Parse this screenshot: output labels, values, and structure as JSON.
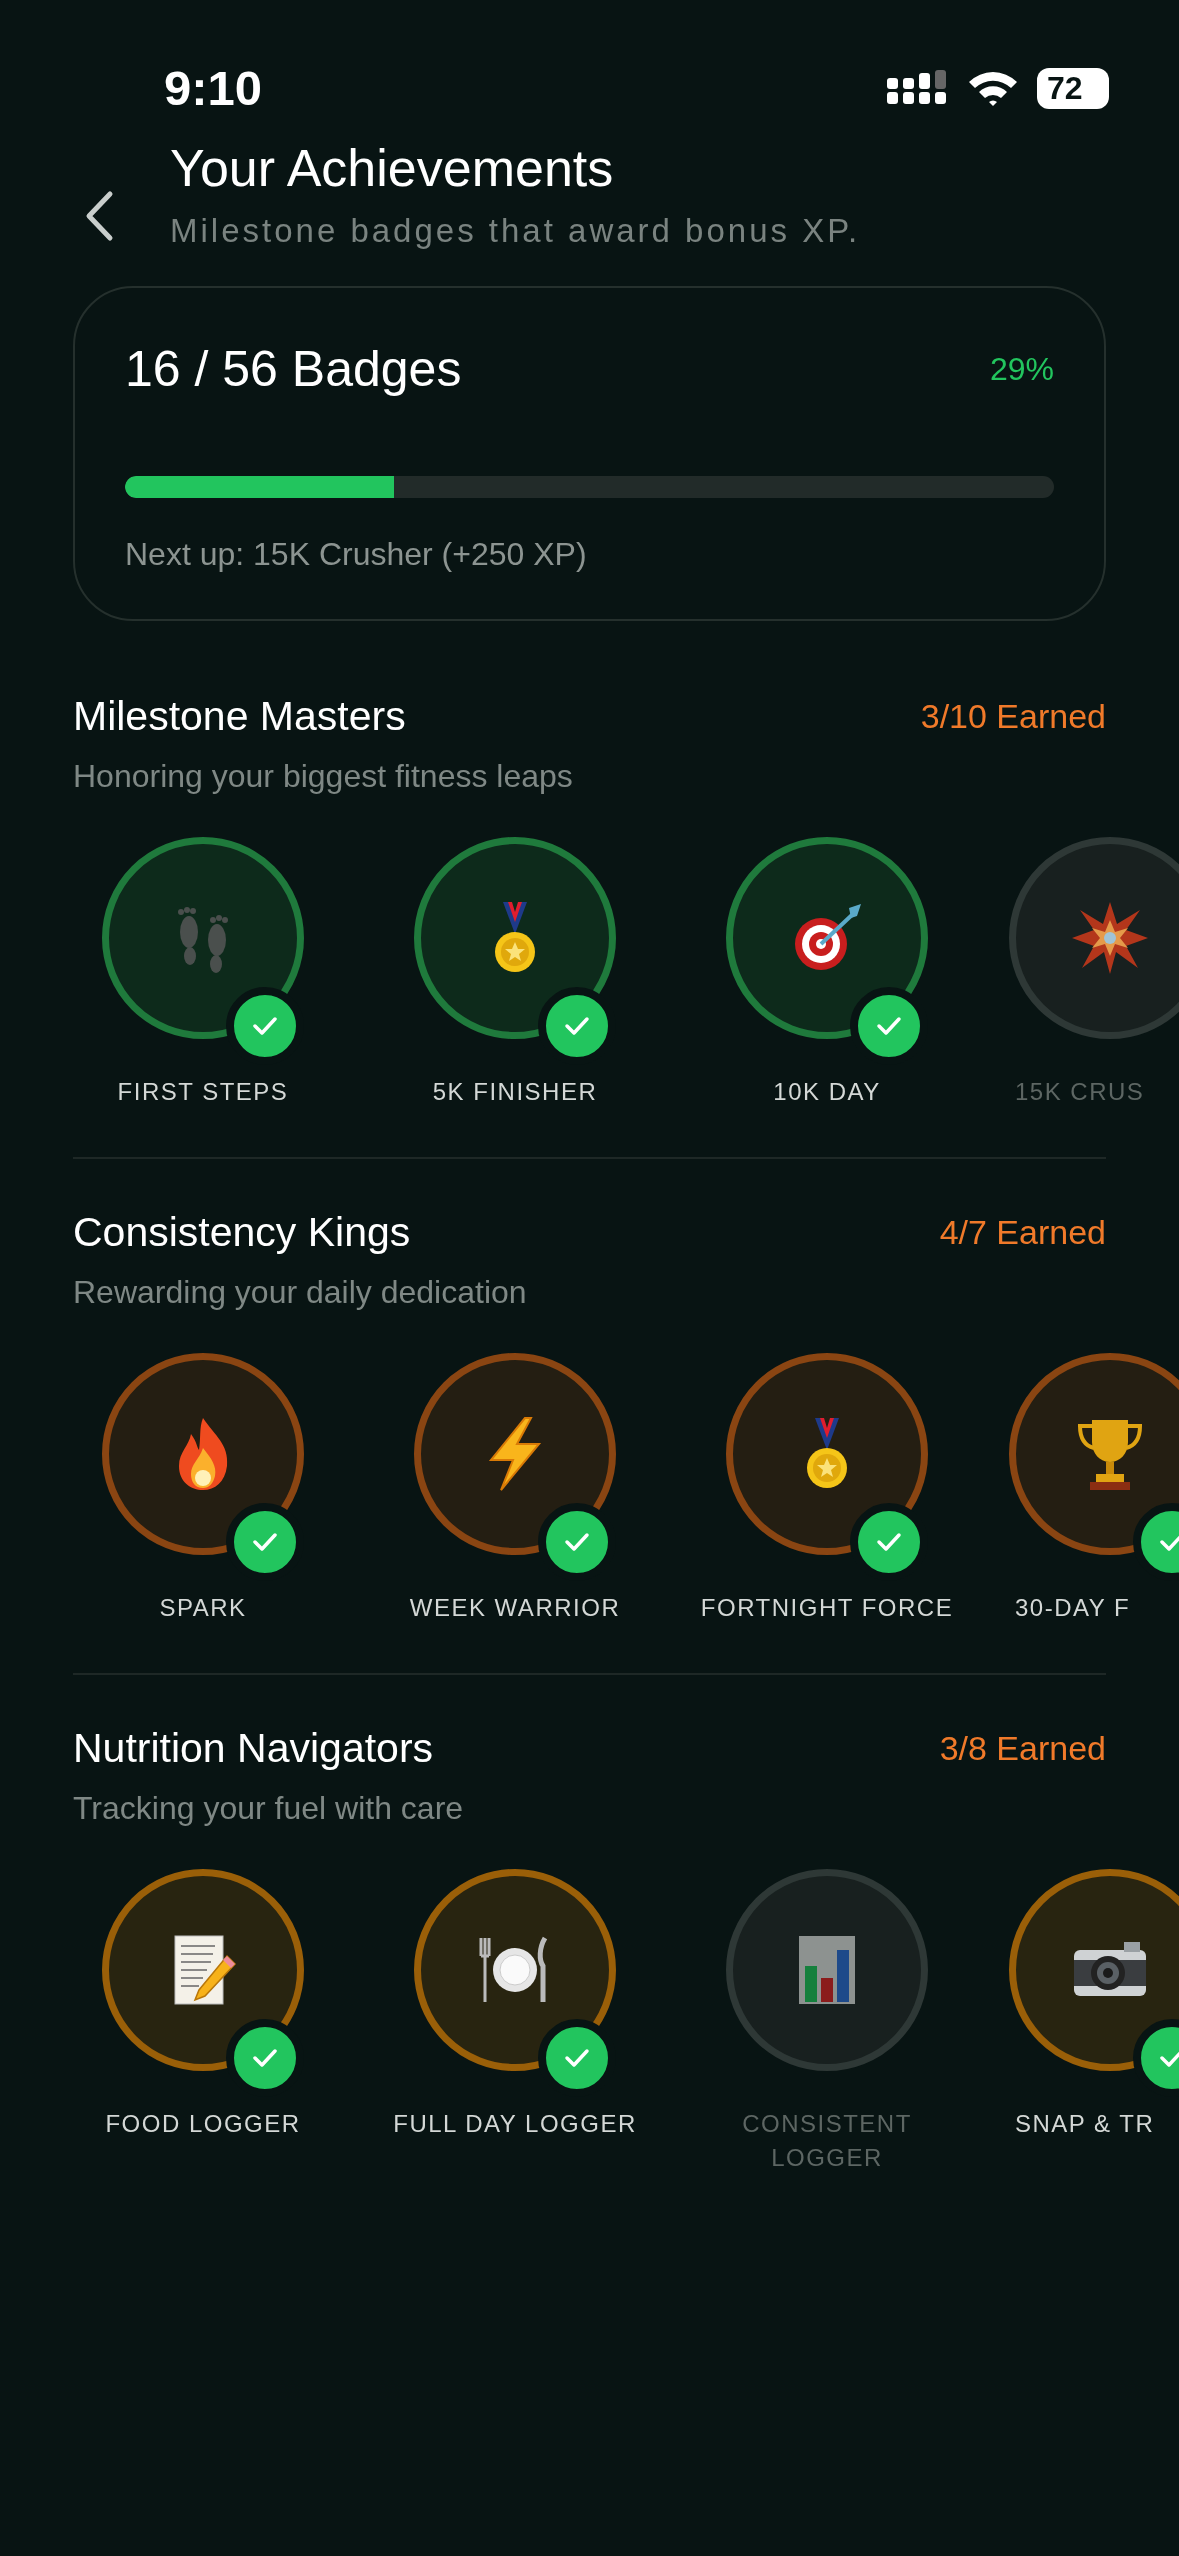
{
  "status_bar": {
    "time": "9:10",
    "battery": "72"
  },
  "header": {
    "title": "Your Achievements",
    "subtitle": "Milestone badges that award bonus XP."
  },
  "summary": {
    "title": "16 / 56 Badges",
    "percent": "29%",
    "level": 0.29,
    "next_up": "Next up: 15K Crusher (+250 XP)"
  },
  "sections": [
    {
      "title": "Milestone Masters",
      "count": "3/10 Earned",
      "subtitle": "Honoring your biggest fitness leaps",
      "color": "#1f7a3c",
      "badges": [
        {
          "label": "FIRST STEPS",
          "earned": true
        },
        {
          "label": "5K FINISHER",
          "earned": true
        },
        {
          "label": "10K DAY",
          "earned": true
        },
        {
          "label": "15K CRUS",
          "earned": false
        }
      ]
    },
    {
      "title": "Consistency Kings",
      "count": "4/7 Earned",
      "subtitle": "Rewarding your daily dedication",
      "color": "#8a4512",
      "badges": [
        {
          "label": "SPARK",
          "earned": true
        },
        {
          "label": "WEEK WARRIOR",
          "earned": true
        },
        {
          "label": "FORTNIGHT FORCE",
          "earned": true
        },
        {
          "label": "30-DAY F",
          "earned": true
        }
      ]
    },
    {
      "title": "Nutrition Navigators",
      "count": "3/8 Earned",
      "subtitle": "Tracking your fuel with care",
      "color": "#9a5f08",
      "badges": [
        {
          "label": "FOOD LOGGER",
          "earned": true
        },
        {
          "label": "FULL DAY LOGGER",
          "earned": true
        },
        {
          "label": "CONSISTENT LOGGER",
          "earned": false
        },
        {
          "label": "SNAP & TR",
          "earned": true
        }
      ]
    }
  ]
}
